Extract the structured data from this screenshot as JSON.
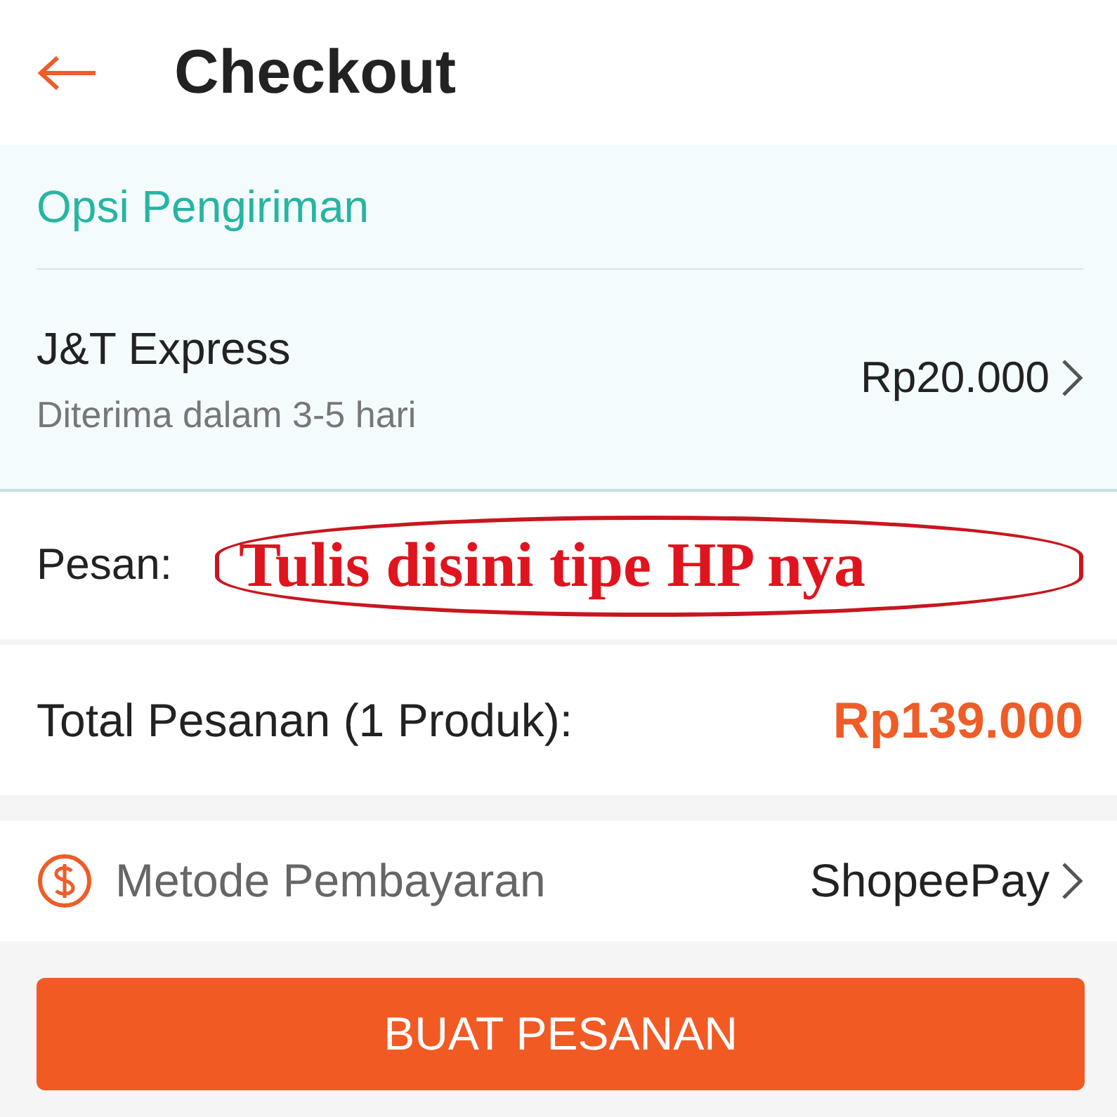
{
  "header": {
    "title": "Checkout"
  },
  "shipping": {
    "title": "Opsi Pengiriman",
    "courier": "J&T Express",
    "estimate": "Diterima dalam 3-5 hari",
    "price": "Rp20.000"
  },
  "message": {
    "label": "Pesan:",
    "annotation": "Tulis disini tipe HP nya"
  },
  "total": {
    "label": "Total Pesanan (1 Produk):",
    "amount": "Rp139.000"
  },
  "payment": {
    "label": "Metode Pembayaran",
    "value": "ShopeePay"
  },
  "buttons": [
    "BUAT PESANAN"
  ]
}
